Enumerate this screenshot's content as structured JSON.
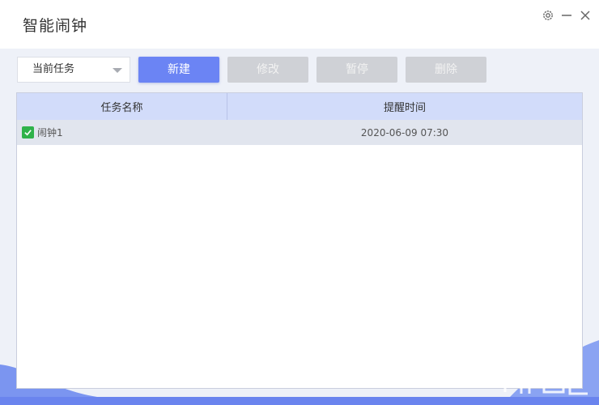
{
  "app": {
    "title": "智能闹钟"
  },
  "window": {
    "settings_icon": "gear-icon",
    "minimize_icon": "minimize-icon",
    "close_icon": "close-icon"
  },
  "toolbar": {
    "filter": {
      "selected": "当前任务"
    },
    "new_label": "新建",
    "edit_label": "修改",
    "pause_label": "暂停",
    "delete_label": "删除"
  },
  "table": {
    "columns": [
      "任务名称",
      "提醒时间"
    ],
    "rows": [
      {
        "checked": true,
        "name": "闹钟1",
        "time": "2020-06-09 07:30"
      }
    ]
  },
  "colors": {
    "accent": "#6b84f4",
    "header": "#d2dcfa",
    "check": "#2fb24a",
    "disabled": "#cfd1d6"
  }
}
